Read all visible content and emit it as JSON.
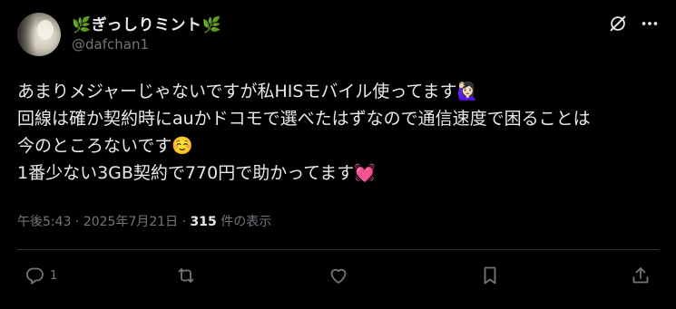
{
  "post": {
    "author": {
      "display_name": "🌿ぎっしりミント🌿",
      "handle": "@dafchan1"
    },
    "text_lines": [
      "あまりメジャーじゃないですが私HISモバイル使ってます🙋🏻‍♀️",
      "回線は確か契約時にauかドコモで選べたはずなので通信速度で困ることは",
      "今のところないです☺️",
      "1番少ない3GB契約で770円で助かってます💓"
    ],
    "meta": {
      "time": "午後5:43",
      "separator": "·",
      "date": "2025年7月21日",
      "views_count": "315",
      "views_label": "件の表示"
    },
    "actions": {
      "reply_count": "1",
      "repost_count": "",
      "like_count": ""
    },
    "icons": {
      "grok": "grok-icon",
      "more": "more-icon",
      "reply": "reply-icon",
      "repost": "repost-icon",
      "like": "heart-icon",
      "bookmark": "bookmark-icon",
      "share": "share-icon"
    },
    "colors": {
      "background": "#000000",
      "text": "#e7e9ea",
      "secondary_text": "#71767b",
      "divider": "#2f3336"
    }
  }
}
